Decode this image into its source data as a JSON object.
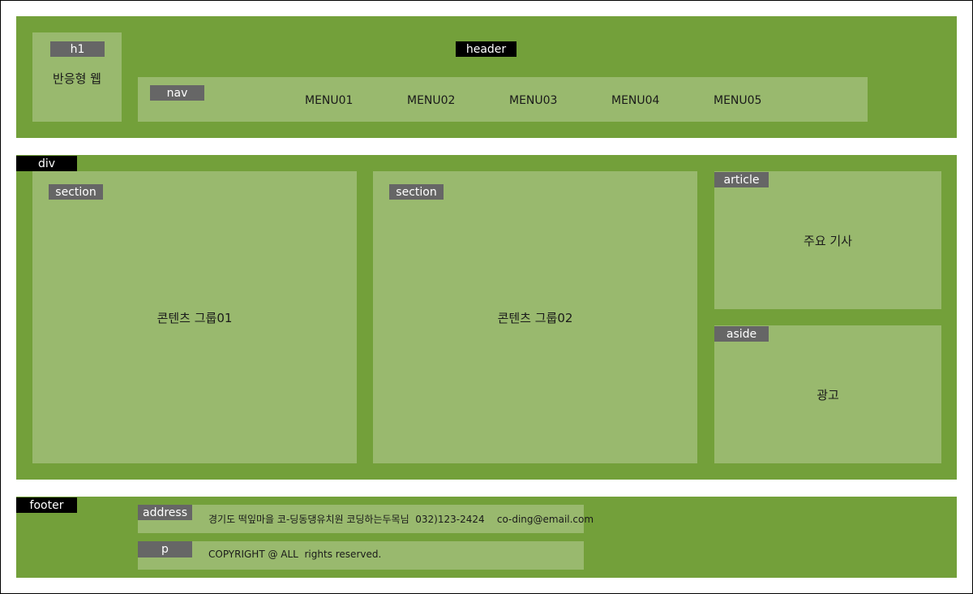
{
  "header": {
    "tag": "header",
    "h1": {
      "tag": "h1",
      "title": "반응형 웹"
    },
    "nav": {
      "tag": "nav",
      "items": [
        "MENU01",
        "MENU02",
        "MENU03",
        "MENU04",
        "MENU05"
      ]
    }
  },
  "container": {
    "tag": "div",
    "sections": [
      {
        "tag": "section",
        "text": "콘텐츠 그룹01"
      },
      {
        "tag": "section",
        "text": "콘텐츠 그룹02"
      }
    ],
    "article": {
      "tag": "article",
      "text": "주요 기사"
    },
    "aside": {
      "tag": "aside",
      "text": "광고"
    }
  },
  "footer": {
    "tag": "footer",
    "address": {
      "tag": "address",
      "text": "경기도 떡잎마을 코-딩동댕유치원 코딩하는두목님  032)123-2424    co-ding@email.com"
    },
    "p": {
      "tag": "p",
      "text": "COPYRIGHT @ ALL  rights reserved."
    }
  },
  "colors": {
    "dark_green": "#73a03a",
    "light_green": "#99b96e",
    "black_tag": "#000000",
    "gray_tag": "#666666"
  }
}
